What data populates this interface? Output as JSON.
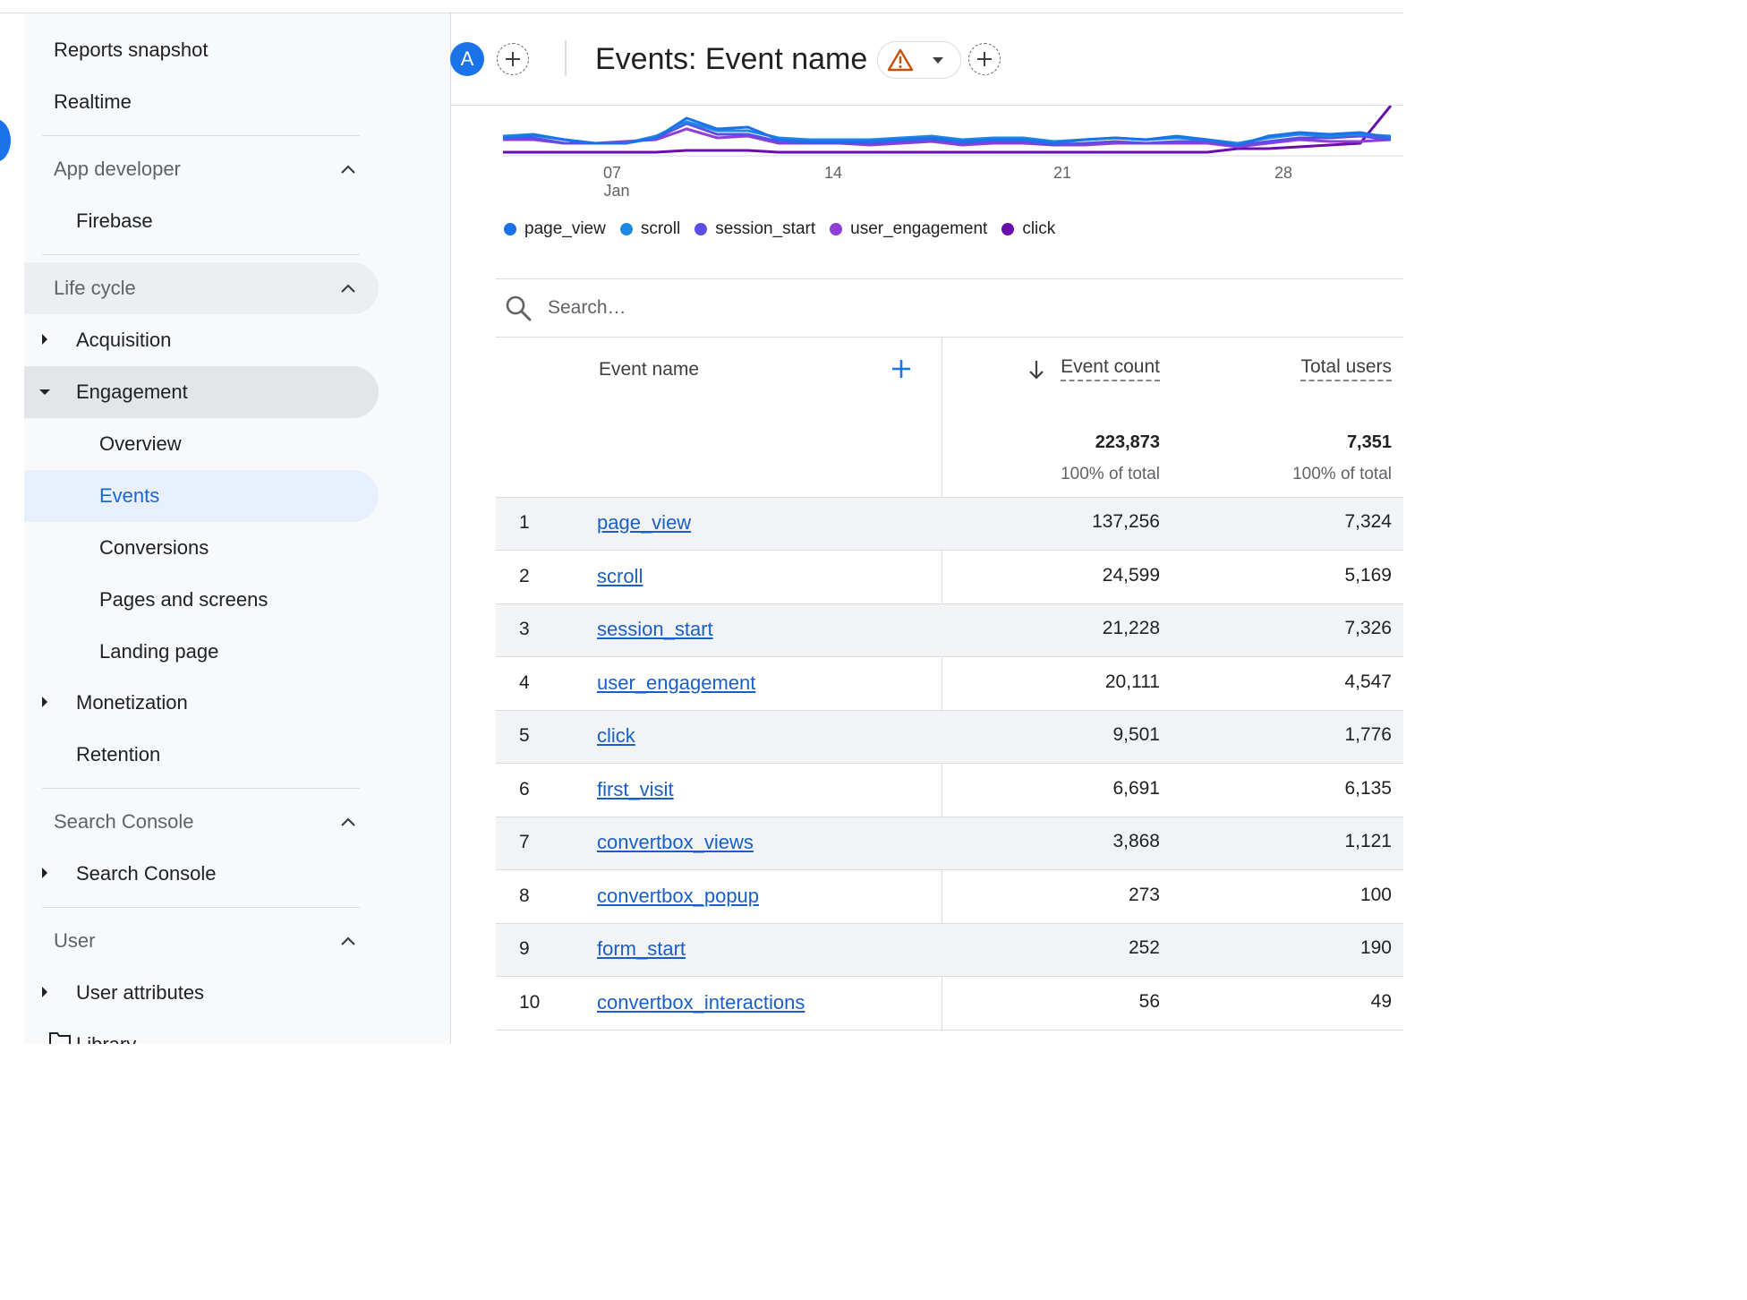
{
  "sidebar": {
    "top_items": [
      "Reports snapshot",
      "Realtime"
    ],
    "app_developer": {
      "label": "App developer",
      "items": [
        "Firebase"
      ]
    },
    "life_cycle": {
      "label": "Life cycle",
      "acquisition": "Acquisition",
      "engagement": "Engagement",
      "engagement_children": [
        "Overview",
        "Events",
        "Conversions",
        "Pages and screens",
        "Landing page"
      ],
      "monetization": "Monetization",
      "retention": "Retention"
    },
    "search_console": {
      "label": "Search Console",
      "items": [
        "Search Console"
      ]
    },
    "user": {
      "label": "User",
      "items": [
        "User attributes"
      ]
    },
    "library": "Library",
    "active_item": "Events"
  },
  "header": {
    "avatar_letter": "A",
    "title": "Events: Event name"
  },
  "chart_data": {
    "type": "line",
    "x_tick_labels": [
      "07",
      "14",
      "21",
      "28"
    ],
    "x_tick_sublabel": "Jan",
    "legend": [
      {
        "name": "page_view",
        "color": "#1a73e8"
      },
      {
        "name": "scroll",
        "color": "#1e88e5"
      },
      {
        "name": "session_start",
        "color": "#5c4ee5"
      },
      {
        "name": "user_engagement",
        "color": "#8e3fd6"
      },
      {
        "name": "click",
        "color": "#6a0dad"
      }
    ]
  },
  "search": {
    "placeholder": "Search…"
  },
  "table": {
    "columns": {
      "event_name": "Event name",
      "event_count": "Event count",
      "total_users": "Total users"
    },
    "totals": {
      "event_count": "223,873",
      "event_count_pct": "100% of total",
      "total_users": "7,351",
      "total_users_pct": "100% of total"
    },
    "rows": [
      {
        "idx": "1",
        "name": "page_view",
        "count": "137,256",
        "users": "7,324"
      },
      {
        "idx": "2",
        "name": "scroll",
        "count": "24,599",
        "users": "5,169"
      },
      {
        "idx": "3",
        "name": "session_start",
        "count": "21,228",
        "users": "7,326"
      },
      {
        "idx": "4",
        "name": "user_engagement",
        "count": "20,111",
        "users": "4,547"
      },
      {
        "idx": "5",
        "name": "click",
        "count": "9,501",
        "users": "1,776"
      },
      {
        "idx": "6",
        "name": "first_visit",
        "count": "6,691",
        "users": "6,135"
      },
      {
        "idx": "7",
        "name": "convertbox_views",
        "count": "3,868",
        "users": "1,121"
      },
      {
        "idx": "8",
        "name": "convertbox_popup",
        "count": "273",
        "users": "100"
      },
      {
        "idx": "9",
        "name": "form_start",
        "count": "252",
        "users": "190"
      },
      {
        "idx": "10",
        "name": "convertbox_interactions",
        "count": "56",
        "users": "49"
      }
    ]
  }
}
